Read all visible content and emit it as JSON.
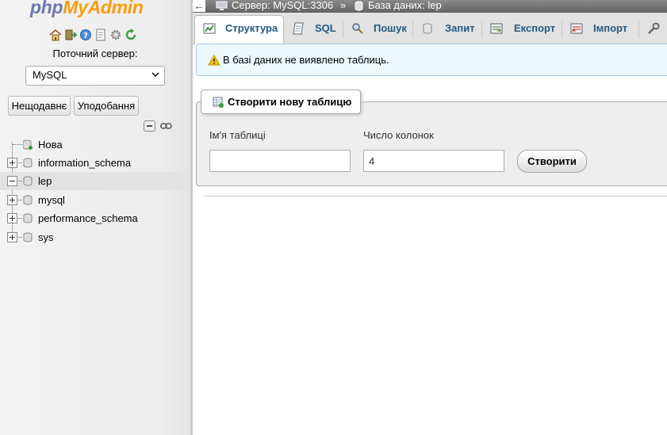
{
  "logo": {
    "part1": "php",
    "part2": "MyAdmin"
  },
  "nav_icons": [
    "home-icon",
    "logout-icon",
    "help-icon",
    "docs-icon",
    "settings-icon",
    "reload-icon"
  ],
  "server_label": "Поточний сервер:",
  "server_select": "MySQL",
  "nav_buttons": {
    "recent": "Нещодавнє",
    "favorites": "Уподобання"
  },
  "tree": [
    {
      "label": "Нова",
      "expander": "none"
    },
    {
      "label": "information_schema",
      "expander": "plus"
    },
    {
      "label": "lep",
      "expander": "minus",
      "selected": true
    },
    {
      "label": "mysql",
      "expander": "plus"
    },
    {
      "label": "performance_schema",
      "expander": "plus"
    },
    {
      "label": "sys",
      "expander": "plus"
    }
  ],
  "breadcrumb": {
    "server": "Сервер: MySQL:3306",
    "separator": "»",
    "database": "База даних: lep"
  },
  "tabs": [
    {
      "label": "Структура",
      "icon": "structure-icon",
      "active": true
    },
    {
      "label": "SQL",
      "icon": "sql-icon"
    },
    {
      "label": "Пошук",
      "icon": "search-icon"
    },
    {
      "label": "Запит",
      "icon": "query-icon"
    },
    {
      "label": "Експорт",
      "icon": "export-icon"
    },
    {
      "label": "Імпорт",
      "icon": "import-icon"
    }
  ],
  "notice": "В базі даних не виявлено таблиць.",
  "create_table": {
    "legend": "Створити нову таблицю",
    "name_label": "Ім'я таблиці",
    "name_value": "",
    "columns_label": "Число колонок",
    "columns_value": "4",
    "submit": "Створити"
  },
  "colors": {
    "accent": "#235a81",
    "logo_blue": "#6c78af",
    "logo_orange": "#f89c0e",
    "notice_bg": "#ebf8fd"
  }
}
